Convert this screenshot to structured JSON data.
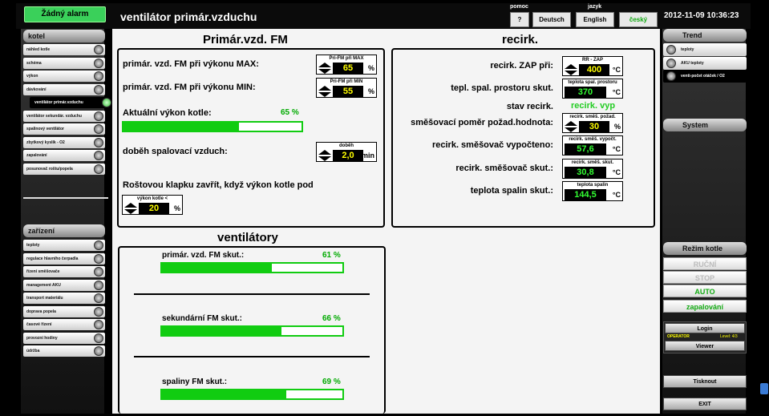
{
  "header": {
    "alarm": "Žádný alarm",
    "title": "ventilátor primár.vzduchu",
    "help_label": "pomoc",
    "help_btn": "?",
    "lang_label": "jazyk",
    "lang_de": "Deutsch",
    "lang_en": "English",
    "lang_cz": "český",
    "datetime": "2012-11-09 10:36:23"
  },
  "left": {
    "section1": "kotel",
    "items1": [
      "náhled kotle",
      "schéma",
      "výkon",
      "dávkování",
      "ventilátor primár.vzduchu",
      "ventilátor sekundár. vzduchu",
      "spalinový ventilátor",
      "zbytkový kyslík - O2",
      "zapalování",
      "posunovač roštu/popela"
    ],
    "section2": "zařízení",
    "items2": [
      "teploty",
      "regulace hlavního čerpadla",
      "řízení směšovače",
      "management AKU",
      "transport materiálu",
      "doprava popela",
      "časové řízení",
      "provozní hodiny",
      "údržba"
    ]
  },
  "right": {
    "trend": "Trend",
    "trend_items": [
      "teploty",
      "AKU teploty",
      "venti-počet otáček / O2"
    ],
    "system": "System",
    "mode_title": "Režim kotle",
    "modes": [
      "RUČNÍ",
      "STOP",
      "AUTO",
      "zapalování"
    ],
    "login": "Login",
    "operator": "OPERATOR",
    "level": "Level: 4/3",
    "viewer": "Viewer",
    "print": "Tisknout",
    "exit": "EXIT"
  },
  "fm": {
    "heading": "Primár.vzd. FM",
    "max_label": "primár. vzd. FM při výkonu MAX:",
    "max_title": "Pri-FM při MAX",
    "max_value": "65",
    "max_unit": "%",
    "min_label": "primár. vzd. FM při výkonu MIN:",
    "min_title": "Pri-FM při MIN",
    "min_value": "55",
    "min_unit": "%",
    "power_label": "Aktuální výkon kotle:",
    "power_pct": "65 %",
    "power_value": 65,
    "after_label": "doběh spalovací vzduch:",
    "after_title": "doběh",
    "after_value": "2,0",
    "after_unit": "min",
    "grate_label": "Roštovou klapku zavřít, když výkon kotle pod",
    "grate_title": "výkon kotle <",
    "grate_value": "20",
    "grate_unit": "%"
  },
  "recirc": {
    "heading": "recirk.",
    "on_label": "recirk. ZAP při:",
    "on_title": "RR - ZAP",
    "on_value": "400",
    "on_unit": "°C",
    "room_label": "tepl. spal. prostoru skut.",
    "room_title": "teplota spal. prostoru",
    "room_value": "370",
    "room_unit": "°C",
    "state_label": "stav recirk.",
    "state_value": "recirk. vyp",
    "mix_label": "směšovací poměr požad.hodnota:",
    "mix_title": "recirk. směš. požad.",
    "mix_value": "30",
    "mix_unit": "%",
    "calc_label": "recirk. směšovač vypočteno:",
    "calc_title": "recirk. směš. vypočt.",
    "calc_value": "57,6",
    "calc_unit": "°C",
    "act_label": "recirk. směšovač skut.:",
    "act_title": "recirk. směš. skut.",
    "act_value": "30,8",
    "act_unit": "°C",
    "flue_label": "teplota spalin skut.:",
    "flue_title": "teplota spalin",
    "flue_value": "144,5",
    "flue_unit": "°C"
  },
  "fans": {
    "heading": "ventilátory",
    "items": [
      {
        "label": "primár. vzd. FM skut.:",
        "pct": "61 %",
        "value": 61
      },
      {
        "label": "sekundární FM skut.:",
        "pct": "66 %",
        "value": 66
      },
      {
        "label": "spaliny FM skut.:",
        "pct": "69 %",
        "value": 69
      }
    ]
  }
}
